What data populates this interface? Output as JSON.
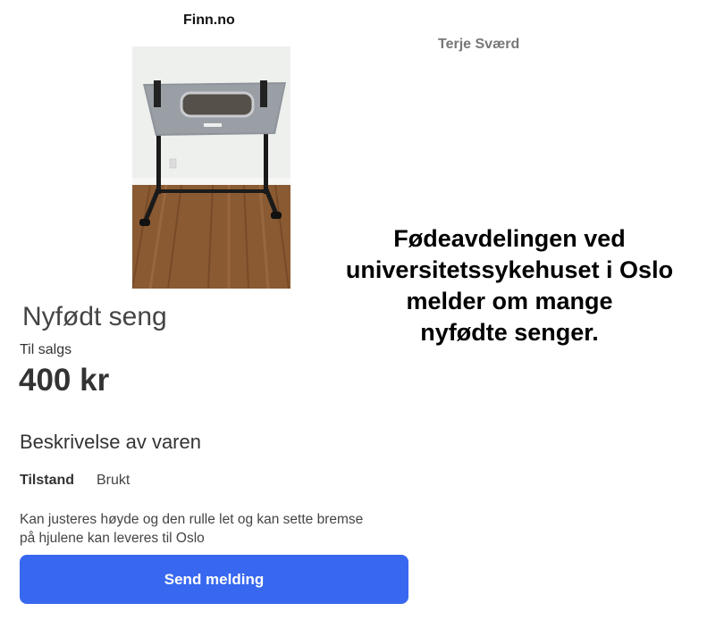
{
  "header": {
    "source": "Finn.no",
    "author": "Terje Sværd"
  },
  "headline": {
    "lines": [
      "Fødeavdelingen ved",
      "universitetssykehuset i Oslo",
      "melder om mange",
      "nyfødte senger."
    ]
  },
  "listing": {
    "title": "Nyfødt seng",
    "sale_label": "Til salgs",
    "price": "400 kr",
    "section_title": "Beskrivelse av varen",
    "condition_label": "Tilstand",
    "condition_value": "Brukt",
    "description_lines": [
      "Kan justeres høyde og den rulle let og kan sette bremse",
      "på hjulene kan leveres til Oslo"
    ],
    "send_button_label": "Send melding"
  },
  "colors": {
    "button": "#3868ef",
    "headline": "#000000"
  }
}
